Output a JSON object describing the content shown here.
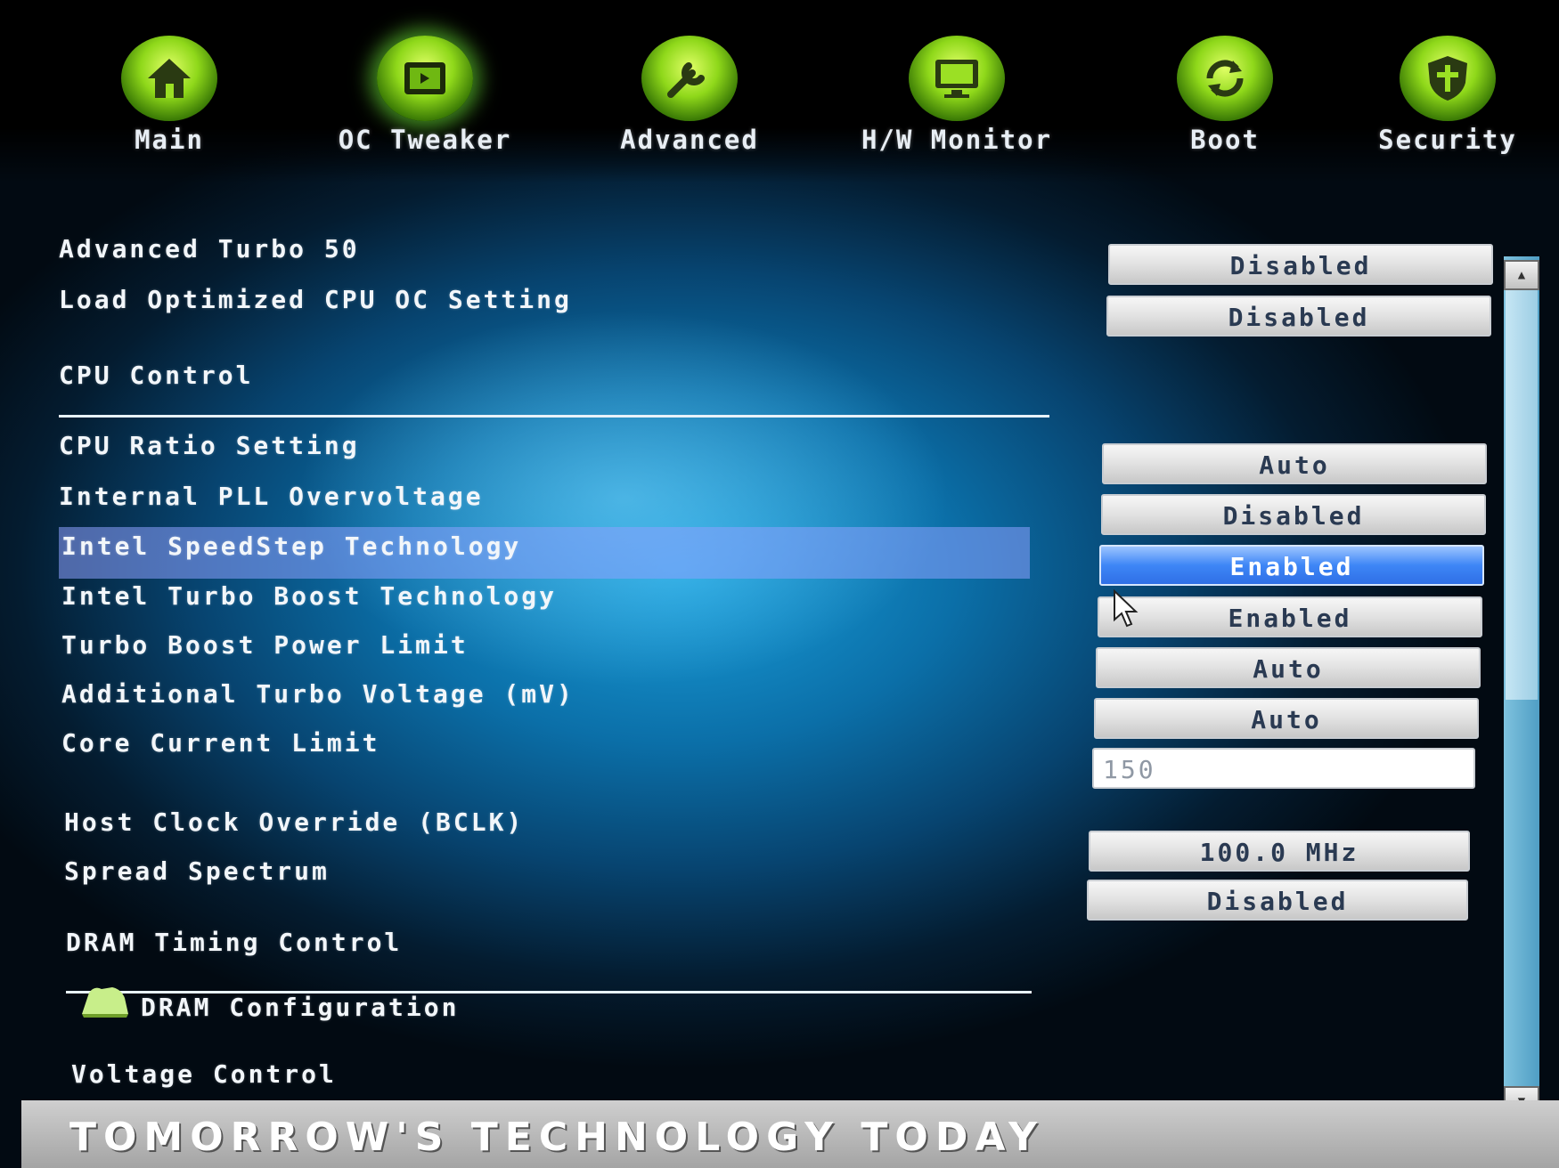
{
  "tabs": [
    {
      "label": "Main",
      "icon": "home-icon"
    },
    {
      "label": "OC Tweaker",
      "icon": "oc-tweaker-icon"
    },
    {
      "label": "Advanced",
      "icon": "wrench-icon"
    },
    {
      "label": "H/W Monitor",
      "icon": "monitor-icon"
    },
    {
      "label": "Boot",
      "icon": "refresh-icon"
    },
    {
      "label": "Security",
      "icon": "shield-icon"
    }
  ],
  "active_tab": "OC Tweaker",
  "settings": {
    "advanced_turbo": {
      "label": "Advanced Turbo 50",
      "value": "Disabled"
    },
    "load_optimized": {
      "label": "Load Optimized CPU OC Setting",
      "value": "Disabled"
    },
    "cpu_control_header": "CPU Control",
    "cpu_ratio": {
      "label": "CPU Ratio Setting",
      "value": "Auto"
    },
    "pll_overvoltage": {
      "label": "Internal PLL Overvoltage",
      "value": "Disabled"
    },
    "speedstep": {
      "label": "Intel SpeedStep Technology",
      "value": "Enabled"
    },
    "turbo_boost": {
      "label": "Intel Turbo Boost Technology",
      "value": "Enabled"
    },
    "turbo_power_limit": {
      "label": "Turbo Boost Power Limit",
      "value": "Auto"
    },
    "turbo_voltage": {
      "label": "Additional Turbo Voltage (mV)",
      "value": "Auto"
    },
    "core_current_limit": {
      "label": "Core Current Limit",
      "value": "150"
    },
    "host_clock": {
      "label": "Host Clock Override (BCLK)",
      "value": "100.0 MHz"
    },
    "spread_spectrum": {
      "label": "Spread Spectrum",
      "value": "Disabled"
    },
    "dram_timing_header": "DRAM Timing Control",
    "dram_config": {
      "label": "DRAM Configuration"
    },
    "voltage_control_header": "Voltage Control"
  },
  "footer": {
    "text": "TOMORROW'S TECHNOLOGY TODAY"
  },
  "colors": {
    "accent_green": "#8fd81a",
    "highlight": "#3e86f6"
  }
}
